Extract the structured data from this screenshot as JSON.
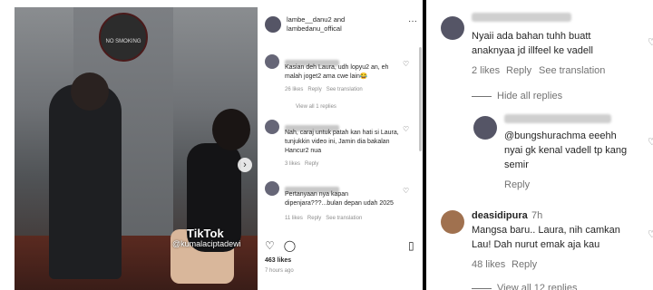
{
  "video": {
    "sign_text": "NO SMOKING",
    "tiktok_logo": "TikTok",
    "tiktok_handle": "@kumalaciptadewi"
  },
  "panel": {
    "header_line1": "lambe__danu2 and",
    "header_line2": "lambedanu_offical",
    "more": "···",
    "comments": [
      {
        "text": "Kasian deh Laura, udh lopyu2 an, eh malah joget2 ama cwe lain😂",
        "likes": "26 likes",
        "reply": "Reply",
        "see": "See translation",
        "view": "View all 1 replies"
      },
      {
        "text": "Nah, caraj untuk patah kan hati si Laura, tunjukkin video ini, Jamin dia bakalan Hancur2 nua",
        "likes": "3 likes",
        "reply": "Reply"
      },
      {
        "text": "Pertanyaan nya kapan dipenjara???...bulan depan udah 2025",
        "likes": "11 likes",
        "reply": "Reply",
        "see": "See translation"
      }
    ],
    "likes": "463 likes",
    "ago": "7 hours ago"
  },
  "right": {
    "c1_text_1": "Nyaii ada bahan tuhh buatt",
    "c1_text_2": "anaknyaa jd illfeel ke vadell",
    "c1_likes": "2 likes",
    "c1_reply": "Reply",
    "c1_see": "See translation",
    "hide": "Hide all replies",
    "c2_text_1": "@bungshurachma eeehh",
    "c2_text_2": "nyai gk kenal vadell tp kang",
    "c2_text_3": "semir",
    "c2_reply": "Reply",
    "c3_user": "deasidipura",
    "c3_time": "7h",
    "c3_text_1": "Mangsa baru.. Laura, nih camkan",
    "c3_text_2": "Lau! Dah nurut emak aja kau",
    "c3_likes": "48 likes",
    "c3_reply": "Reply",
    "view_more": "View all 12 replies"
  }
}
